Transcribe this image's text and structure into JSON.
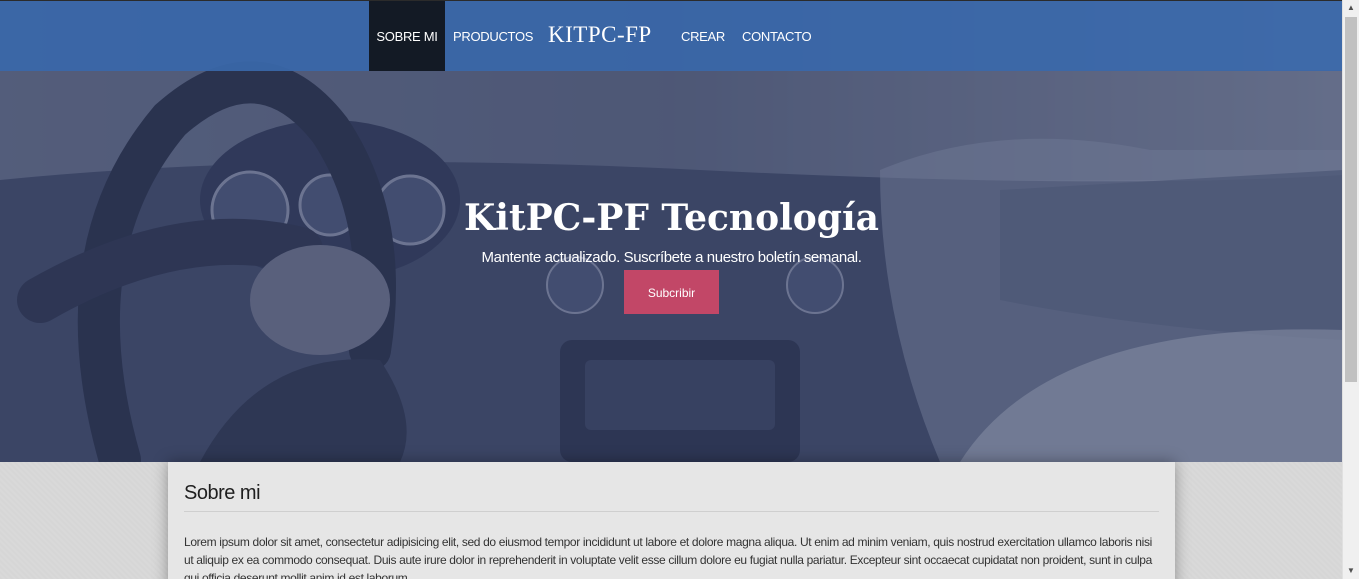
{
  "nav": {
    "items": [
      {
        "label": "SOBRE MI",
        "active": true
      },
      {
        "label": "PRODUCTOS",
        "active": false
      },
      {
        "label": "CREAR",
        "active": false
      },
      {
        "label": "CONTACTO",
        "active": false
      }
    ],
    "brand": "KITPC-FP"
  },
  "hero": {
    "title": "KitPC-PF Tecnología",
    "subtitle": "Mantente actualizado. Suscríbete a nuestro boletín semanal.",
    "button_label": "Subcribir"
  },
  "about": {
    "title": "Sobre mi",
    "text": "Lorem ipsum dolor sit amet, consectetur adipisicing elit, sed do eiusmod tempor incididunt ut labore et dolore magna aliqua. Ut enim ad minim veniam, quis nostrud exercitation ullamco laboris nisi ut aliquip ex ea commodo consequat. Duis aute irure dolor in reprehenderit in voluptate velit esse cillum dolore eu fugiat nulla pariatur. Excepteur sint occaecat cupidatat non proident, sunt in culpa qui officia deserunt mollit anim id est laborum."
  },
  "colors": {
    "nav_bg": "#3a68aa",
    "nav_active": "#131a25",
    "button": "#c24767"
  }
}
